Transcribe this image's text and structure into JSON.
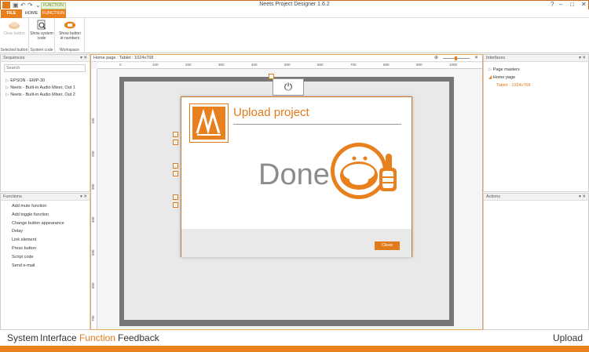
{
  "app": {
    "title": "Neets Project Designer 1.6.2",
    "accent": "#e8801e"
  },
  "ribbon_tabs": {
    "file": "FILE",
    "home": "HOME",
    "function": "FUNCTION",
    "contextual_label": "FUNCTION"
  },
  "ribbon": {
    "clear_button": "Clear button",
    "show_system_code": "Show system code",
    "show_button_id_numbers": "Show button id numbers",
    "group_selected_button": "Selected button",
    "group_system_code": "System code",
    "group_workspace": "Workspace"
  },
  "sequences": {
    "title": "Sequences",
    "search_placeholder": "Search",
    "items": [
      "EPSON - EMP-30",
      "Neets - Built-in Audio Mixer, Out 1",
      "Neets - Built-in Audio Mixer, Out 2"
    ]
  },
  "functions": {
    "title": "Functions",
    "items": [
      "Add mute function",
      "Add toggle function",
      "Change button appearance",
      "Delay",
      "Link element",
      "Press button",
      "Script code",
      "Send e-mail"
    ]
  },
  "canvas": {
    "header": "Home page : Tablet : 1024x768",
    "ruler_h": [
      "0",
      "100",
      "200",
      "300",
      "400",
      "500",
      "600",
      "700",
      "800",
      "900",
      "1000"
    ],
    "ruler_v": [
      "100",
      "200",
      "300",
      "400",
      "500",
      "600",
      "700"
    ]
  },
  "interfaces": {
    "title": "Interfaces",
    "items": [
      {
        "label": "Page masters",
        "level": 0
      },
      {
        "label": "Home page",
        "level": 0
      },
      {
        "label": "Tablet : 1024x768",
        "level": 1
      }
    ]
  },
  "actions": {
    "title": "Actions"
  },
  "modal": {
    "title": "Upload project",
    "status": "Done",
    "close_label": "Close"
  },
  "bottom_nav": {
    "items": [
      "System",
      "Interface",
      "Function",
      "Feedback"
    ],
    "active": "Function",
    "upload": "Upload"
  }
}
